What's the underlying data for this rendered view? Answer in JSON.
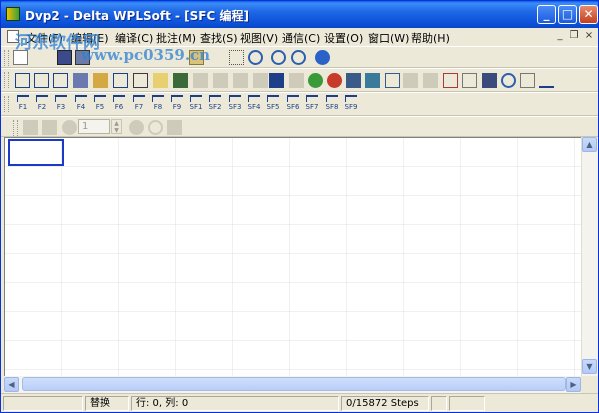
{
  "window": {
    "title": "Dvp2 - Delta WPLSoft - [SFC 编程]",
    "minimize_glyph": "_",
    "maximize_glyph": "□",
    "close_glyph": "✕"
  },
  "menubar": {
    "items": [
      "文件(F)",
      "编辑(E)",
      "编译(C)",
      "批注(M)",
      "查找(S)",
      "视图(V)",
      "通信(C)",
      "设置(O)",
      "窗口(W)",
      "帮助(H)"
    ],
    "mdi_minimize": "_",
    "mdi_restore": "❐",
    "mdi_close": "×"
  },
  "watermark": {
    "top": "河东软件网",
    "url": "www.pc0359.cn"
  },
  "function_keys": {
    "labels": [
      "F1",
      "F2",
      "F3",
      "F4",
      "F5",
      "F6",
      "F7",
      "F8",
      "F9",
      "SF1",
      "SF2",
      "SF3",
      "SF4",
      "SF5",
      "SF6",
      "SF7",
      "SF8",
      "SF9"
    ]
  },
  "toolbar4": {
    "step_value": "1"
  },
  "statusbar": {
    "mode": "替换",
    "position": "行: 0, 列: 0",
    "steps": "0/15872 Steps"
  },
  "colors": {
    "titlebar": "#0B50D8",
    "window_bg": "#ECE9D8",
    "cursor": "#1a39c8",
    "watermark": "#2d7fd4"
  }
}
